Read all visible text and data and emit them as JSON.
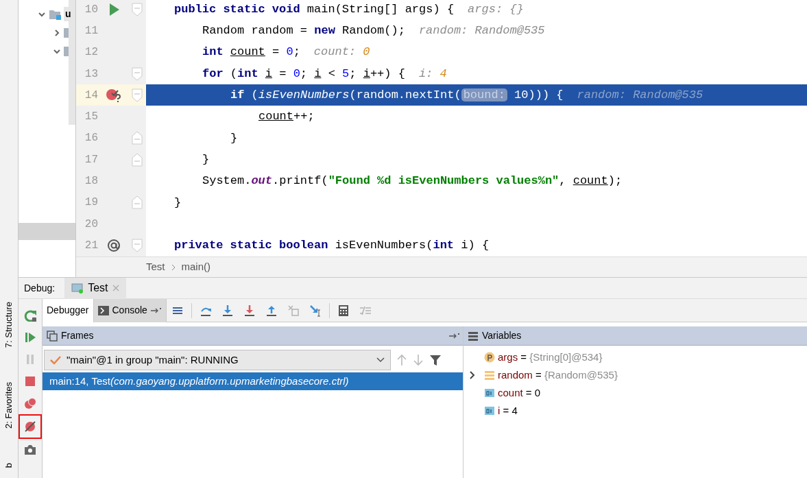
{
  "left_strip": [
    {
      "label": "7: Structure"
    },
    {
      "label": "2: Favorites"
    },
    {
      "label": "b"
    }
  ],
  "project_tree": [
    {
      "kind": "folder",
      "expanded": true,
      "label": "u"
    },
    {
      "kind": "package",
      "expanded": false
    },
    {
      "kind": "package",
      "expanded": true
    }
  ],
  "editor": {
    "lines": [
      {
        "number": "10",
        "marker": {
          "kind": "run"
        },
        "fold": {
          "kind": "start"
        },
        "current": false,
        "tokens": [
          {
            "kind": "kw",
            "text": "public static void"
          },
          {
            "kind": "plain",
            "text": " main(String[] args) {"
          },
          {
            "kind": "hint",
            "text": "args: {}"
          }
        ],
        "children": [
          {
            "number": "11",
            "current": false,
            "tokens": [
              {
                "kind": "plain",
                "text": "Random random = "
              },
              {
                "kind": "kw",
                "text": "new"
              },
              {
                "kind": "plain",
                "text": " Random();"
              },
              {
                "kind": "hint",
                "text": "random: Random@535"
              }
            ]
          },
          {
            "number": "12",
            "current": false,
            "tokens": [
              {
                "kind": "kw",
                "text": "int "
              },
              {
                "kind": "var",
                "text": "count"
              },
              {
                "kind": "plain",
                "text": " = "
              },
              {
                "kind": "num",
                "text": "0"
              },
              {
                "kind": "plain",
                "text": ";"
              },
              {
                "kind": "hint",
                "text": "count: "
              },
              {
                "kind": "hintnum",
                "text": "0"
              }
            ]
          },
          {
            "number": "13",
            "fold": {
              "kind": "start"
            },
            "current": false,
            "tokens": [
              {
                "kind": "kw",
                "text": "for"
              },
              {
                "kind": "plain",
                "text": " ("
              },
              {
                "kind": "kw",
                "text": "int "
              },
              {
                "kind": "var",
                "text": "i"
              },
              {
                "kind": "plain",
                "text": " = "
              },
              {
                "kind": "num",
                "text": "0"
              },
              {
                "kind": "plain",
                "text": "; "
              },
              {
                "kind": "var",
                "text": "i"
              },
              {
                "kind": "plain",
                "text": " < "
              },
              {
                "kind": "num",
                "text": "5"
              },
              {
                "kind": "plain",
                "text": "; "
              },
              {
                "kind": "var",
                "text": "i"
              },
              {
                "kind": "plain",
                "text": "++) {"
              },
              {
                "kind": "hint",
                "text": "i: "
              },
              {
                "kind": "hintnum",
                "text": "4"
              }
            ],
            "children": [
              {
                "number": "14",
                "marker": {
                  "kind": "breakpoint"
                },
                "fold": {
                  "kind": "start"
                },
                "current": true,
                "tokens": [
                  {
                    "kind": "kw",
                    "text": "if"
                  },
                  {
                    "kind": "plain",
                    "text": " ("
                  },
                  {
                    "kind": "method",
                    "text": "isEvenNumbers"
                  },
                  {
                    "kind": "plain",
                    "text": "(random.nextInt("
                  },
                  {
                    "kind": "param",
                    "text": "bound:"
                  },
                  {
                    "kind": "plain",
                    "text": " 10))) {"
                  },
                  {
                    "kind": "hint",
                    "text": "random: Random@535"
                  }
                ],
                "children": [
                  {
                    "number": "15",
                    "current": false,
                    "tokens": [
                      {
                        "kind": "var",
                        "text": "count"
                      },
                      {
                        "kind": "plain",
                        "text": "++;"
                      }
                    ]
                  }
                ]
              },
              {
                "number": "16",
                "fold": {
                  "kind": "end"
                },
                "current": false,
                "tokens": [
                  {
                    "kind": "plain",
                    "text": "}"
                  }
                ]
              }
            ]
          },
          {
            "number": "17",
            "fold": {
              "kind": "end"
            },
            "current": false,
            "tokens": [
              {
                "kind": "plain",
                "text": "}"
              }
            ]
          },
          {
            "number": "18",
            "current": false,
            "tokens": [
              {
                "kind": "plain",
                "text": "System."
              },
              {
                "kind": "static",
                "text": "out"
              },
              {
                "kind": "plain",
                "text": ".printf("
              },
              {
                "kind": "str",
                "text": "\"Found %d isEvenNumbers values%n\""
              },
              {
                "kind": "plain",
                "text": ", "
              },
              {
                "kind": "var",
                "text": "count"
              },
              {
                "kind": "plain",
                "text": ");"
              }
            ]
          }
        ]
      },
      {
        "number": "19",
        "fold": {
          "kind": "end"
        },
        "current": false,
        "tokens": [
          {
            "kind": "plain",
            "text": "}"
          }
        ]
      },
      {
        "number": "20",
        "current": false
      },
      {
        "number": "21",
        "marker": {
          "kind": "override"
        },
        "fold": {
          "kind": "start"
        },
        "current": false,
        "tokens": [
          {
            "kind": "kw",
            "text": "private static boolean"
          },
          {
            "kind": "plain",
            "text": " isEvenNumbers("
          },
          {
            "kind": "kw",
            "text": "int"
          },
          {
            "kind": "plain",
            "text": " i) {"
          }
        ]
      }
    ]
  },
  "breadcrumb": [
    "Test",
    "main()"
  ],
  "debug": {
    "title": "Debug:",
    "session_tab": "Test",
    "side_toolbar": [
      {
        "kind": "rerun",
        "disabled": false,
        "highlighted": false
      },
      {
        "kind": "resume",
        "disabled": false,
        "highlighted": false
      },
      {
        "kind": "pause",
        "disabled": true,
        "highlighted": false
      },
      {
        "kind": "stop",
        "disabled": false,
        "highlighted": false
      },
      {
        "kind": "breakpoints",
        "disabled": false,
        "highlighted": false
      },
      {
        "kind": "mute",
        "disabled": false,
        "highlighted": true
      },
      {
        "kind": "camera",
        "disabled": false,
        "highlighted": false
      }
    ],
    "tabs": [
      {
        "label": "Debugger",
        "selected": true
      },
      {
        "label": "Console",
        "selected": false
      }
    ],
    "toolbar": [
      {
        "kind": "frames",
        "disabled": false
      },
      {
        "kind": "step-over",
        "disabled": false
      },
      {
        "kind": "step-into",
        "disabled": false
      },
      {
        "kind": "force-step-into",
        "disabled": false
      },
      {
        "kind": "step-out",
        "disabled": false
      },
      {
        "kind": "drop-frame",
        "disabled": true
      },
      {
        "kind": "run-to-cursor",
        "disabled": false
      },
      {
        "kind": "evaluate",
        "disabled": false
      },
      {
        "kind": "trace",
        "disabled": true
      }
    ],
    "frames": {
      "title": "Frames",
      "thread": "\"main\"@1 in group \"main\": RUNNING",
      "rows": [
        {
          "location": "main:14, Test",
          "package": "(com.gaoyang.upplatform.upmarketingbasecore.ctrl)",
          "selected": true
        }
      ]
    },
    "variables": {
      "title": "Variables",
      "rows": [
        {
          "kind": "param",
          "name": "args",
          "operator": "=",
          "value": "{String[0]@534}",
          "expandable": false
        },
        {
          "kind": "object",
          "name": "random",
          "operator": "=",
          "value": "{Random@535}",
          "expandable": true
        },
        {
          "kind": "primitive",
          "name": "count",
          "operator": "=",
          "value": "0",
          "expandable": false
        },
        {
          "kind": "primitive",
          "name": "i",
          "operator": "=",
          "value": "4",
          "expandable": false
        }
      ]
    }
  }
}
